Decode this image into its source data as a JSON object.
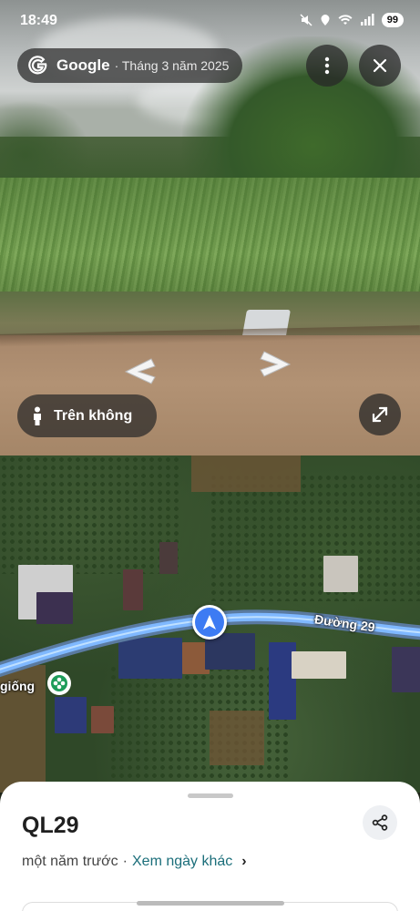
{
  "status_bar": {
    "time": "18:49",
    "battery": "99"
  },
  "street_view": {
    "brand": "Google",
    "capture_date": "· Tháng 3 năm 2025",
    "mode_label": "Trên không",
    "icons": {
      "more": "more-vert-icon",
      "close": "close-icon",
      "expand": "expand-icon",
      "pegman": "pegman-icon",
      "nav_left": "chevron-left-icon",
      "nav_right": "chevron-right-icon"
    }
  },
  "map": {
    "street_name": "Đường 29",
    "place_label_partial": "giống",
    "route_color": "#7fb8ff",
    "pin_color": "#3d7bf3"
  },
  "sheet": {
    "title": "QL29",
    "relative_time": "một năm trước",
    "separator": "·",
    "other_dates_link": "Xem ngày khác",
    "share_icon": "share-icon"
  }
}
